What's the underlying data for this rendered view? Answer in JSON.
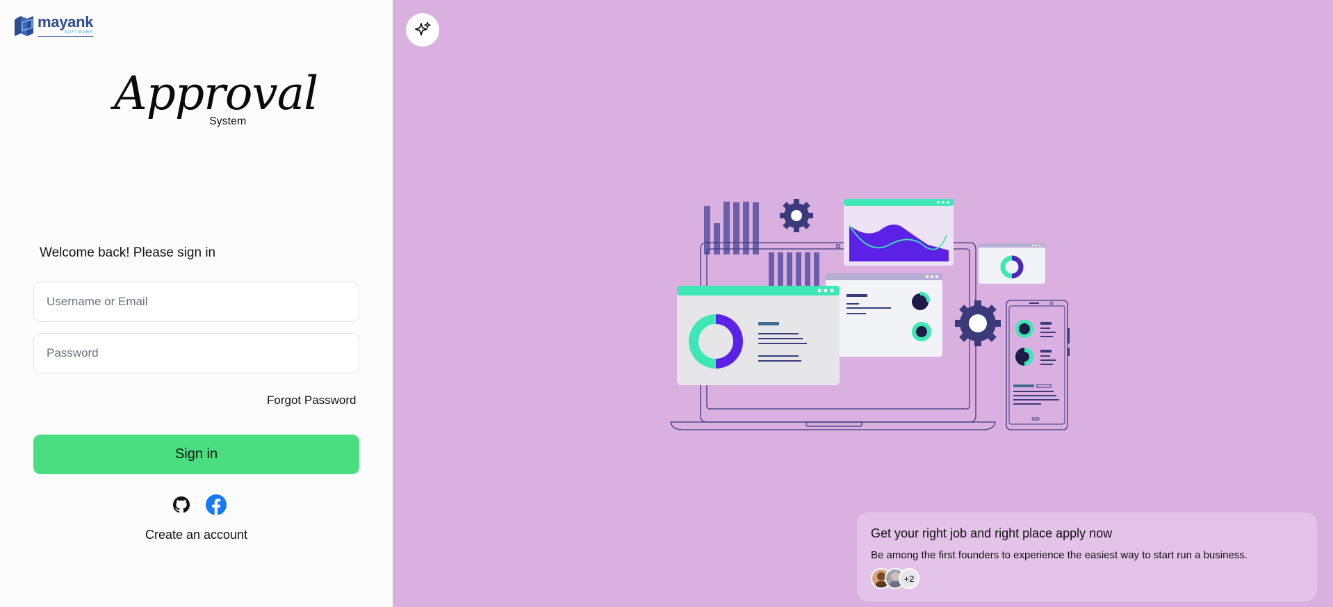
{
  "brand": {
    "name": "mayank",
    "sub": "SOFTWARE"
  },
  "app_logo": {
    "script": "Approval",
    "sub": "System"
  },
  "login": {
    "welcome": "Welcome back! Please sign in",
    "username_placeholder": "Username or Email",
    "password_placeholder": "Password",
    "forgot_label": "Forgot Password",
    "signin_label": "Sign in",
    "create_label": "Create an account"
  },
  "social": {
    "icons": [
      "github-icon",
      "facebook-icon"
    ]
  },
  "promo": {
    "title": "Get your right job and right place apply now",
    "subtitle": "Be among the first founders to experience the easiest way to start run a business.",
    "more_count": "+2"
  },
  "colors": {
    "right_bg": "#d9b0e0",
    "primary_button": "#4ade80",
    "accent_teal": "#3ee8b5",
    "accent_purple": "#5b21e6",
    "navy": "#3b3a7a"
  }
}
